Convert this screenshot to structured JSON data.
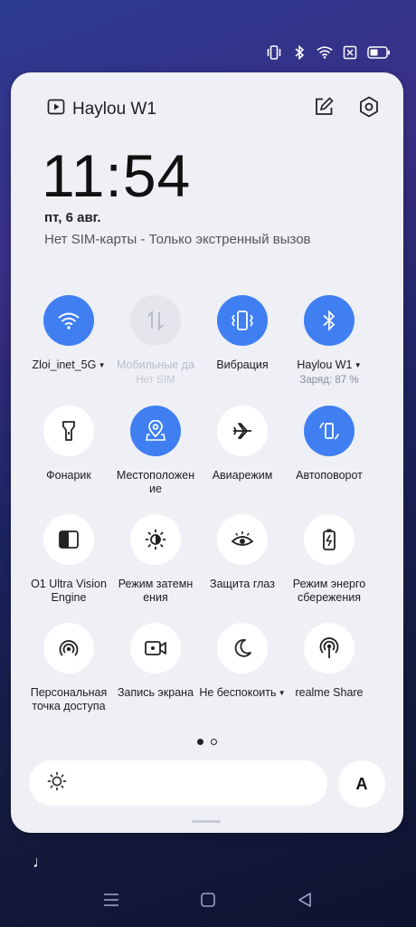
{
  "device": {
    "name": "Haylou W1"
  },
  "time": "11:54",
  "date": "пт, 6 авг.",
  "sim_status": "Нет SIM-карты - Только экстренный вызов",
  "tiles": [
    {
      "label": "Zloi_inet_5G",
      "sub": "",
      "state": "on",
      "icon": "wifi-icon",
      "caret": true
    },
    {
      "label": "Мобильные да",
      "sub": "Нет SIM",
      "state": "disabled",
      "icon": "mobile-data-icon",
      "caret": false
    },
    {
      "label": "Вибрация",
      "sub": "",
      "state": "on",
      "icon": "vibration-icon",
      "caret": false
    },
    {
      "label": "Haylou W1",
      "sub": "Заряд: 87 %",
      "state": "on",
      "icon": "bluetooth-icon",
      "caret": true
    },
    {
      "label": "Фонарик",
      "sub": "",
      "state": "off",
      "icon": "flashlight-icon",
      "caret": false
    },
    {
      "label": "Местоположен ие",
      "sub": "",
      "state": "on",
      "icon": "location-icon",
      "caret": false
    },
    {
      "label": "Авиарежим",
      "sub": "",
      "state": "off",
      "icon": "airplane-icon",
      "caret": false
    },
    {
      "label": "Автоповорот",
      "sub": "",
      "state": "on",
      "icon": "autorotate-icon",
      "caret": false
    },
    {
      "label": "O1 Ultra Vision Engine",
      "sub": "",
      "state": "off",
      "icon": "vision-engine-icon",
      "caret": false
    },
    {
      "label": "Режим затемн ения",
      "sub": "",
      "state": "off",
      "icon": "dark-mode-icon",
      "caret": false
    },
    {
      "label": "Защита глаз",
      "sub": "",
      "state": "off",
      "icon": "eye-icon",
      "caret": false
    },
    {
      "label": "Режим энерго сбережения",
      "sub": "",
      "state": "off",
      "icon": "battery-saver-icon",
      "caret": false
    },
    {
      "label": "Персональная точка доступа",
      "sub": "",
      "state": "off",
      "icon": "hotspot-icon",
      "caret": false
    },
    {
      "label": "Запись экрана",
      "sub": "",
      "state": "off",
      "icon": "screen-record-icon",
      "caret": false
    },
    {
      "label": "Не беспокоить",
      "sub": "",
      "state": "off",
      "icon": "moon-icon",
      "caret": true
    },
    {
      "label": "realme Share",
      "sub": "",
      "state": "off",
      "icon": "share-icon",
      "caret": false
    }
  ],
  "auto_brightness_label": "A",
  "colors": {
    "accent": "#3f7ff2",
    "panel": "#eef0f5"
  }
}
